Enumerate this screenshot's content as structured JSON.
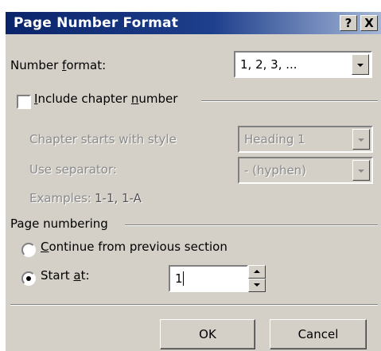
{
  "dialog": {
    "title": "Page Number Format",
    "help_button": "?",
    "close_button": "X"
  },
  "number_format": {
    "label": "Number format:",
    "value": "1, 2, 3, ..."
  },
  "chapter": {
    "include_label": "Include chapter number",
    "include_checked": false,
    "starts_with_label": "Chapter starts with style",
    "starts_with_value": "Heading 1",
    "separator_label": "Use separator:",
    "separator_value": "-   (hyphen)",
    "examples_label": "Examples:",
    "examples_value": "1-1, 1-A"
  },
  "page_numbering": {
    "group_label": "Page numbering",
    "continue_label": "Continue from previous section",
    "start_at_label": "Start at:",
    "start_at_value": "1",
    "selected": "start_at"
  },
  "buttons": {
    "ok": "OK",
    "cancel": "Cancel"
  }
}
